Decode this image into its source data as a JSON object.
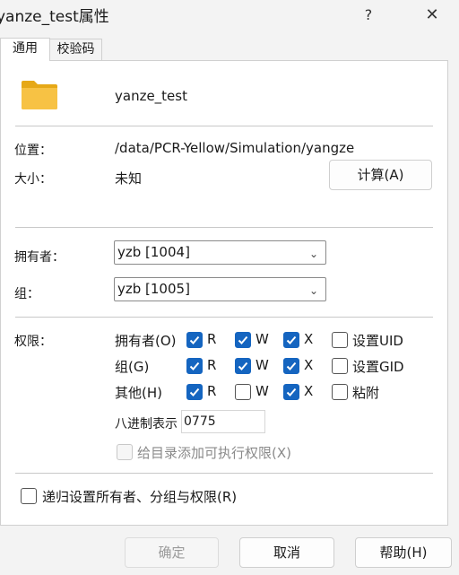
{
  "window": {
    "title": "yanze_test属性",
    "help_glyph": "?",
    "close_glyph": "✕"
  },
  "tabs": [
    "通用",
    "校验码"
  ],
  "general": {
    "name": "yanze_test",
    "location_label": "位置：",
    "location_value": "/data/PCR-Yellow/Simulation/yangze",
    "size_label": "大小：",
    "size_value": "未知",
    "calc_button": "计算(A)",
    "owner_label": "拥有者：",
    "owner_value": "yzb [1004]",
    "group_label": "组：",
    "group_value": "yzb [1005]",
    "perm_label": "权限：",
    "perm_rows": [
      {
        "label": "拥有者(O)",
        "r": true,
        "w": true,
        "x": true,
        "extra_label": "设置UID",
        "extra": false
      },
      {
        "label": "组(G)",
        "r": true,
        "w": true,
        "x": true,
        "extra_label": "设置GID",
        "extra": false
      },
      {
        "label": "其他(H)",
        "r": true,
        "w": false,
        "x": true,
        "extra_label": "粘附",
        "extra": false
      }
    ],
    "perm_letters": {
      "r": "R",
      "w": "W",
      "x": "X"
    },
    "octal_label": "八进制表示",
    "octal_value": "0775",
    "dir_exec_label": "给目录添加可执行权限(X)",
    "recursive_label": "递归设置所有者、分组与权限(R)"
  },
  "buttons": {
    "ok": "确定",
    "cancel": "取消",
    "help": "帮助(H)"
  },
  "colors": {
    "accent": "#1565c0",
    "folder": "#f7c244"
  }
}
